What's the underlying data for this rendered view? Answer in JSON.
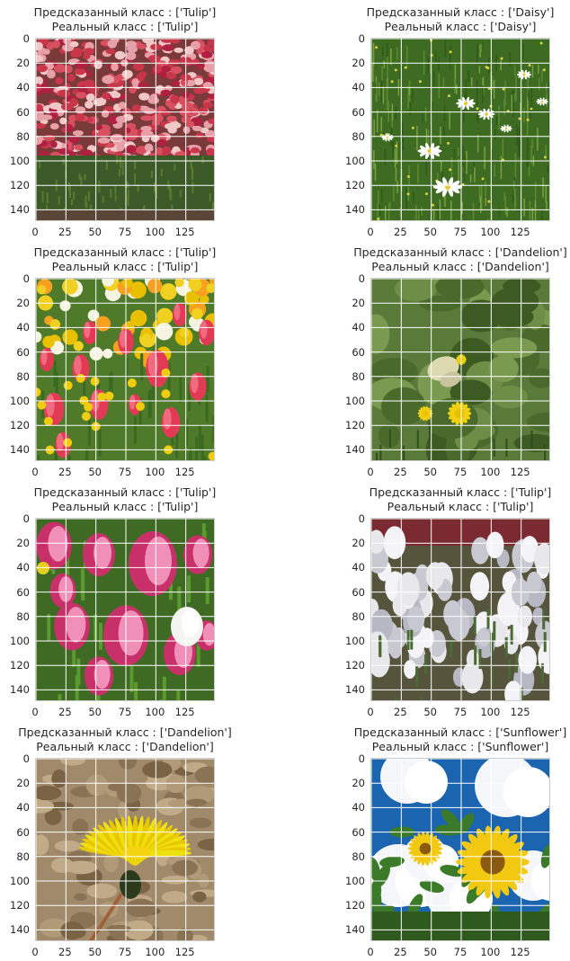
{
  "chart_data": [
    {
      "type": "image",
      "title": [
        "Предсказанный класс : ['Tulip']",
        "Реальный класс : ['Tulip']"
      ],
      "predicted": "Tulip",
      "actual": "Tulip",
      "xticks": [
        "0",
        "25",
        "50",
        "75",
        "100",
        "125"
      ],
      "yticks": [
        "0",
        "20",
        "40",
        "60",
        "80",
        "100",
        "120",
        "140"
      ],
      "xlim": [
        0,
        150
      ],
      "ylim": [
        150,
        0
      ],
      "grid": true,
      "scene": "tulip-field"
    },
    {
      "type": "image",
      "title": [
        "Предсказанный класс : ['Daisy']",
        "Реальный класс : ['Daisy']"
      ],
      "predicted": "Daisy",
      "actual": "Daisy",
      "xticks": [
        "0",
        "25",
        "50",
        "75",
        "100",
        "125"
      ],
      "yticks": [
        "0",
        "20",
        "40",
        "60",
        "80",
        "100",
        "120",
        "140"
      ],
      "xlim": [
        0,
        150
      ],
      "ylim": [
        150,
        0
      ],
      "grid": true,
      "scene": "daisy-grass"
    },
    {
      "type": "image",
      "title": [
        "Предсказанный класс : ['Tulip']",
        "Реальный класс : ['Tulip']"
      ],
      "predicted": "Tulip",
      "actual": "Tulip",
      "xticks": [
        "0",
        "25",
        "50",
        "75",
        "100",
        "125"
      ],
      "yticks": [
        "0",
        "20",
        "40",
        "60",
        "80",
        "100",
        "120",
        "140"
      ],
      "xlim": [
        0,
        150
      ],
      "ylim": [
        150,
        0
      ],
      "grid": true,
      "scene": "red-tulips"
    },
    {
      "type": "image",
      "title": [
        "Предсказанный класс : ['Dandelion']",
        "Реальный класс : ['Dandelion']"
      ],
      "predicted": "Dandelion",
      "actual": "Dandelion",
      "xticks": [
        "0",
        "25",
        "50",
        "75",
        "100",
        "125"
      ],
      "yticks": [
        "0",
        "20",
        "40",
        "60",
        "80",
        "100",
        "120",
        "140"
      ],
      "xlim": [
        0,
        150
      ],
      "ylim": [
        150,
        0
      ],
      "grid": true,
      "scene": "dandelion-butterfly"
    },
    {
      "type": "image",
      "title": [
        "Предсказанный класс : ['Tulip']",
        "Реальный класс : ['Tulip']"
      ],
      "predicted": "Tulip",
      "actual": "Tulip",
      "xticks": [
        "0",
        "25",
        "50",
        "75",
        "100",
        "125"
      ],
      "yticks": [
        "0",
        "20",
        "40",
        "60",
        "80",
        "100",
        "120",
        "140"
      ],
      "xlim": [
        0,
        150
      ],
      "ylim": [
        150,
        0
      ],
      "grid": true,
      "scene": "pink-tulips"
    },
    {
      "type": "image",
      "title": [
        "Предсказанный класс : ['Tulip']",
        "Реальный класс : ['Tulip']"
      ],
      "predicted": "Tulip",
      "actual": "Tulip",
      "xticks": [
        "0",
        "25",
        "50",
        "75",
        "100",
        "125"
      ],
      "yticks": [
        "0",
        "20",
        "40",
        "60",
        "80",
        "100",
        "120",
        "140"
      ],
      "xlim": [
        0,
        150
      ],
      "ylim": [
        150,
        0
      ],
      "grid": true,
      "scene": "white-tulips"
    },
    {
      "type": "image",
      "title": [
        "Предсказанный класс : ['Dandelion']",
        "Реальный класс : ['Dandelion']"
      ],
      "predicted": "Dandelion",
      "actual": "Dandelion",
      "xticks": [
        "0",
        "25",
        "50",
        "75",
        "100",
        "125"
      ],
      "yticks": [
        "0",
        "20",
        "40",
        "60",
        "80",
        "100",
        "120",
        "140"
      ],
      "xlim": [
        0,
        150
      ],
      "ylim": [
        150,
        0
      ],
      "grid": true,
      "scene": "dandelion-closeup"
    },
    {
      "type": "image",
      "title": [
        "Предсказанный класс : ['Sunflower']",
        "Реальный класс : ['Sunflower']"
      ],
      "predicted": "Sunflower",
      "actual": "Sunflower",
      "xticks": [
        "0",
        "25",
        "50",
        "75",
        "100",
        "125"
      ],
      "yticks": [
        "0",
        "20",
        "40",
        "60",
        "80",
        "100",
        "120",
        "140"
      ],
      "xlim": [
        0,
        150
      ],
      "ylim": [
        150,
        0
      ],
      "grid": true,
      "scene": "sunflowers-sky"
    }
  ]
}
